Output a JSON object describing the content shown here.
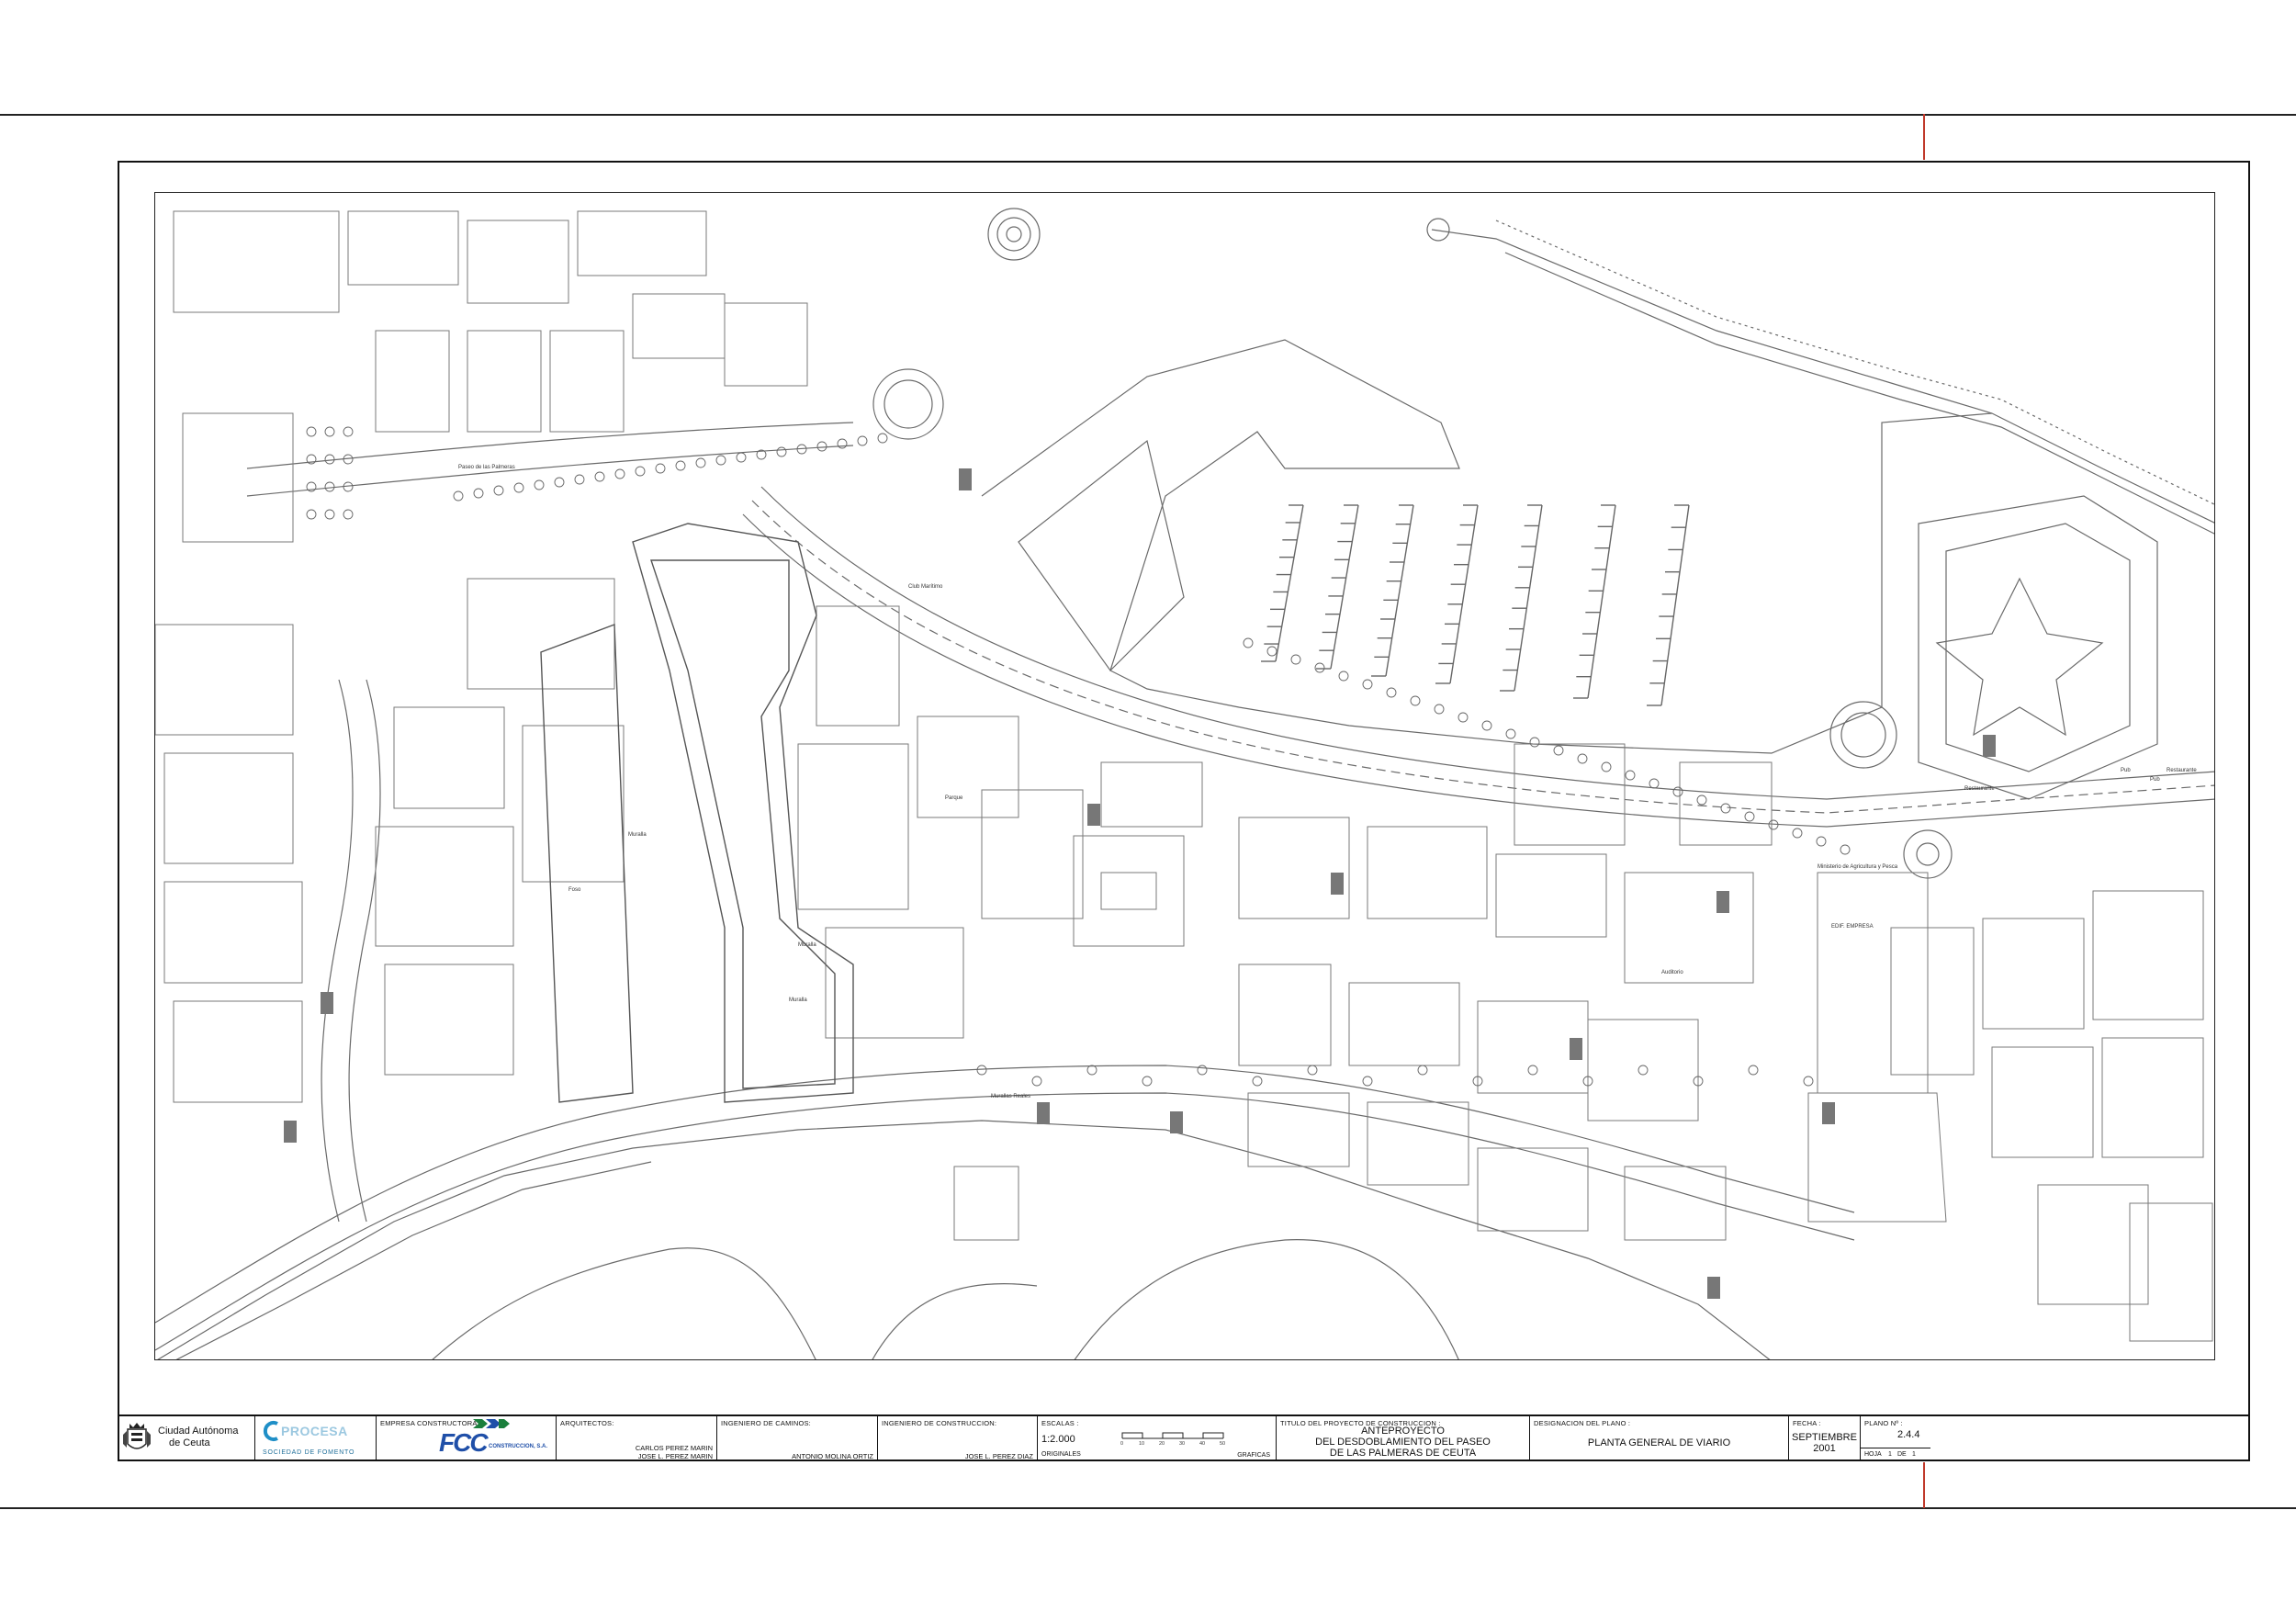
{
  "map_labels": {
    "paseo": "Paseo de las Palmeras",
    "club_maritimo": "Club Marítimo",
    "muralla": "Muralla",
    "muralla_2": "Muralla",
    "foso": "Foso",
    "muralla_lat": "Muralla",
    "parque": "Parque",
    "restaurante": "Restaurante",
    "pub_1": "Pub",
    "pub_2": "Pub",
    "restaurante_2": "Restaurante",
    "ministerio": "Ministerio de Agricultura y Pesca",
    "edif_empresa": "EDIF. EMPRESA",
    "auditorio": "Auditorio",
    "murallas_reales": "Murallas Reales"
  },
  "title_block": {
    "client_line1": "Ciudad Autónoma",
    "client_line2": "de Ceuta",
    "procesa_logo": "PROCESA",
    "procesa_sub": "SOCIEDAD DE FOMENTO",
    "empresa_caption": "EMPRESA CONSTRUCTORA",
    "fcc_logo": "FCC",
    "fcc_sub": "CONSTRUCCION, S.A.",
    "arquitectos_caption": "ARQUITECTOS:",
    "arquitecto_1": "CARLOS PEREZ MARIN",
    "arquitecto_2": "JOSE L. PEREZ MARIN",
    "ing_caminos_caption": "INGENIERO DE CAMINOS:",
    "ing_caminos_name": "ANTONIO MOLINA ORTIZ",
    "ing_construccion_caption": "INGENIERO DE CONSTRUCCION:",
    "ing_construccion_name": "JOSE L. PEREZ DIAZ",
    "escalas_caption": "ESCALAS :",
    "escala_value": "1:2.000",
    "originales": "ORIGINALES",
    "graficas": "GRAFICAS",
    "scale_ticks": [
      "0",
      "10",
      "20",
      "30",
      "40",
      "50"
    ],
    "titulo_caption": "TITULO DEL PROYECTO DE CONSTRUCCION :",
    "titulo_line1": "ANTEPROYECTO",
    "titulo_line2": "DEL DESDOBLAMIENTO DEL PASEO",
    "titulo_line3": "DE LAS PALMERAS DE CEUTA",
    "designacion_caption": "DESIGNACION DEL PLANO :",
    "designacion_value": "PLANTA GENERAL DE VIARIO",
    "fecha_caption": "FECHA :",
    "fecha_month": "SEPTIEMBRE",
    "fecha_year": "2001",
    "plano_caption": "PLANO Nº :",
    "plano_value": "2.4.4",
    "hoja_label": "HOJA",
    "hoja_num": "1",
    "hoja_de": "DE",
    "hoja_total": "1"
  }
}
